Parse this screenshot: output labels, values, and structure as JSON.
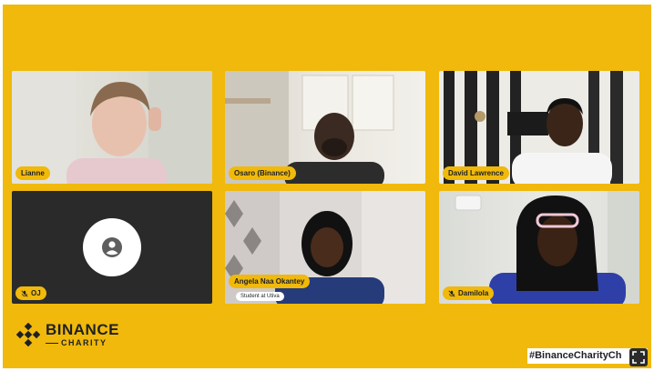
{
  "participants": [
    {
      "name": "Lianne",
      "muted": false
    },
    {
      "name": "Osaro (Binance)",
      "muted": false
    },
    {
      "name": "David Lawrence",
      "muted": false
    },
    {
      "name": "OJ",
      "muted": true,
      "video_off": true
    },
    {
      "name": "Angela Naa Okantey",
      "muted": false,
      "subtitle": "Student at Utiva"
    },
    {
      "name": "Damilola",
      "muted": true
    }
  ],
  "branding": {
    "logo_word": "BINANCE",
    "logo_sub": "CHARITY",
    "hashtag": "#BinanceCharityCh"
  },
  "colors": {
    "brand_yellow": "#f0b90b",
    "dark": "#1e2026"
  },
  "icons": {
    "mic_off": "mic-off-icon",
    "avatar": "user-avatar-icon",
    "fullscreen": "fullscreen-icon",
    "logo": "binance-logo-icon"
  }
}
